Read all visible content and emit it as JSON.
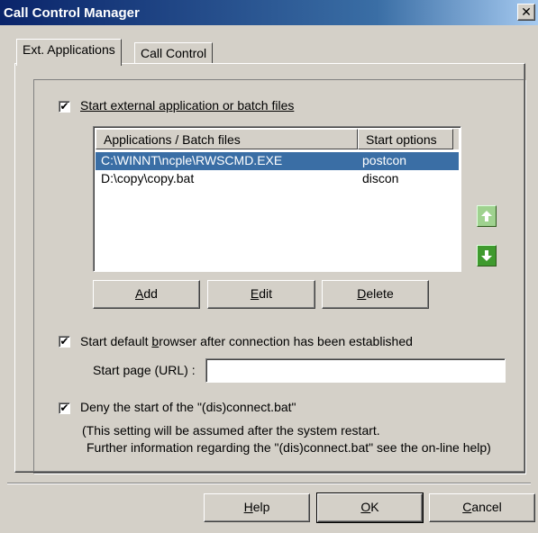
{
  "window": {
    "title": "Call Control Manager",
    "close_glyph": "✕"
  },
  "tabs": [
    {
      "label": "Ext. Applications",
      "active": true
    },
    {
      "label": "Call Control",
      "active": false
    }
  ],
  "start_external": {
    "checked": true,
    "check_glyph": "✔",
    "label": "Start external application or batch files"
  },
  "app_list": {
    "columns": [
      "Applications / Batch files",
      "Start options"
    ],
    "rows": [
      {
        "file": "C:\\WINNT\\ncple\\RWSCMD.EXE",
        "option": "postcon",
        "selected": true
      },
      {
        "file": "D:\\copy\\copy.bat",
        "option": "discon",
        "selected": false
      }
    ],
    "move_up_icon": "arrow-up-icon",
    "move_down_icon": "arrow-down-icon",
    "colors": {
      "arrow_up": "#9fd28f",
      "arrow_down": "#3f9a2e",
      "selection": "#3a6ea5"
    }
  },
  "list_buttons": {
    "add_mnemonic": "A",
    "add_rest": "dd",
    "edit_mnemonic": "E",
    "edit_rest": "dit",
    "delete_mnemonic": "D",
    "delete_rest": "elete"
  },
  "browser": {
    "checked": true,
    "label_pre": "Start default ",
    "label_mnemonic": "b",
    "label_post": "rowser after connection has been established",
    "url_label": "Start page (URL) :",
    "url_value": ""
  },
  "deny": {
    "checked": true,
    "label": "Deny the start of the \"(dis)connect.bat\"",
    "note_line1": "(This setting will be assumed after the system restart.",
    "note_line2": "Further information regarding the \"(dis)connect.bat\" see the on-line help)"
  },
  "footer_buttons": {
    "help_mnemonic": "H",
    "help_rest": "elp",
    "ok_mnemonic": "O",
    "ok_rest": "K",
    "cancel_mnemonic": "C",
    "cancel_rest": "ancel"
  }
}
